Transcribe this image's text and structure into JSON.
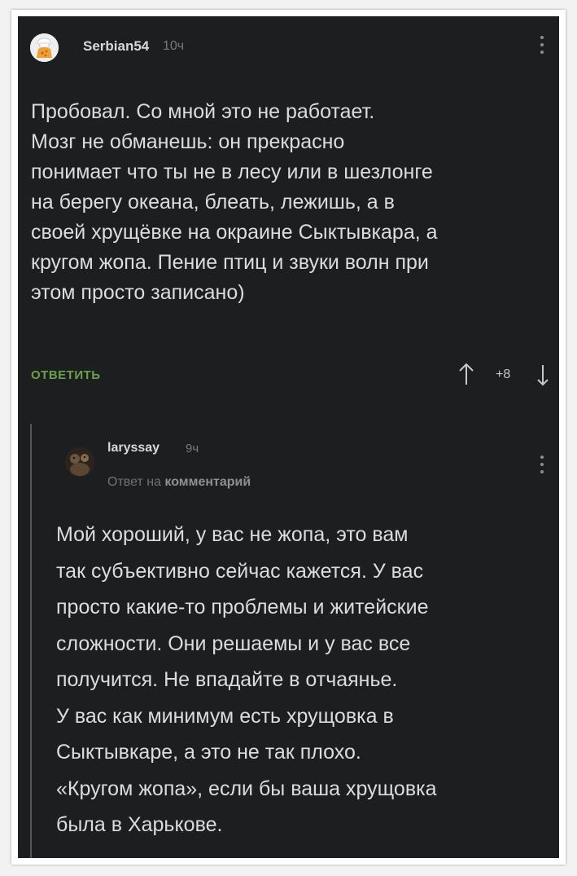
{
  "comment": {
    "username": "Serbian54",
    "time": "10ч",
    "avatar_icon": "chef-avatar-icon",
    "text": "Пробовал. Со мной это не работает.\nМозг не обманешь: он прекрасно\nпонимает что ты не в лесу или в шезлонге\nна берегу океана, блеать, лежишь, а в\nсвоей хрущёвке на окраине Сыктывкара, а\nкругом жопа. Пение птиц и звуки волн при\nэтом просто записано)",
    "reply_label": "ОТВЕТИТЬ",
    "rating": "+8",
    "accent_color": "#6aa24b"
  },
  "reply": {
    "username": "laryssay",
    "time": "9ч",
    "avatar_icon": "user-photo-avatar-icon",
    "reply_to_prefix": "Ответ на",
    "reply_to_link": "комментарий",
    "text": "Мой хороший, у вас не жопа, это вам\nтак субъективно сейчас кажется. У вас\nпросто какие-то проблемы и житейские\nсложности. Они решаемы и у вас все\nполучится. Не впадайте в отчаянье.\n У вас как минимум есть хрущовка в\nСыктывкаре, а это не так плохо.\n«Кругом жопа», если бы ваша хрущовка\nбыла в Харькове."
  }
}
